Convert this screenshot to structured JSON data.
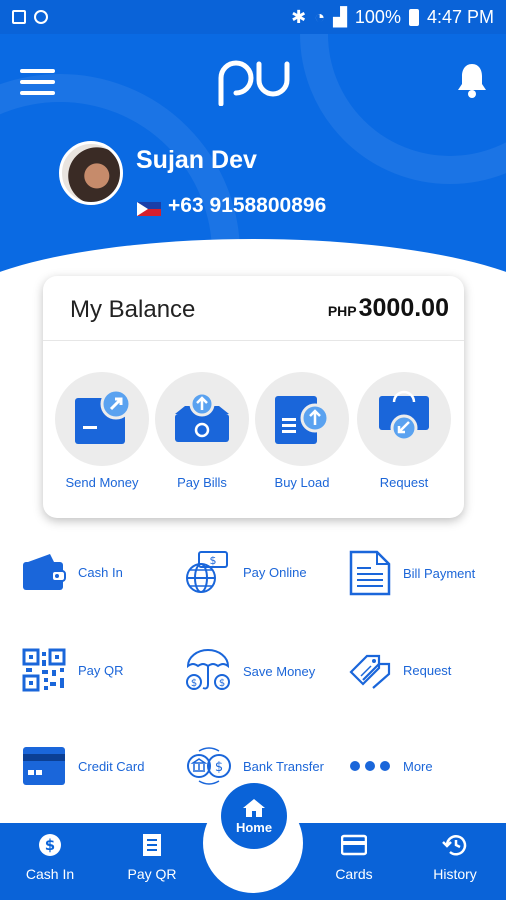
{
  "status_bar": {
    "battery": "100%",
    "time": "4:47 PM"
  },
  "user": {
    "name": "Sujan Dev",
    "phone": "+63 9158800896"
  },
  "balance": {
    "title": "My Balance",
    "currency": "PHP",
    "amount": "3000.00"
  },
  "quick_actions": [
    {
      "label": "Send Money",
      "icon": "send-money-icon"
    },
    {
      "label": "Pay Bills",
      "icon": "pay-bills-icon"
    },
    {
      "label": "Buy Load",
      "icon": "buy-load-icon"
    },
    {
      "label": "Request",
      "icon": "request-icon"
    }
  ],
  "services": [
    {
      "label": "Cash In",
      "icon": "wallet-icon"
    },
    {
      "label": "Pay Online",
      "icon": "globe-money-icon"
    },
    {
      "label": "Bill Payment",
      "icon": "document-icon"
    },
    {
      "label": "Pay QR",
      "icon": "qr-code-icon"
    },
    {
      "label": "Save Money",
      "icon": "umbrella-money-icon"
    },
    {
      "label": "Request",
      "icon": "tag-icon"
    },
    {
      "label": "Credit Card",
      "icon": "credit-card-icon"
    },
    {
      "label": "Bank Transfer",
      "icon": "bank-transfer-icon"
    },
    {
      "label": "More",
      "icon": "more-dots-icon"
    }
  ],
  "bottom_nav": {
    "cash_in": "Cash In",
    "pay_qr": "Pay QR",
    "home": "Home",
    "cards": "Cards",
    "history": "History"
  },
  "colors": {
    "primary": "#0a63d8",
    "accent_text": "#1c66d8",
    "card_bg": "#ffffff"
  }
}
